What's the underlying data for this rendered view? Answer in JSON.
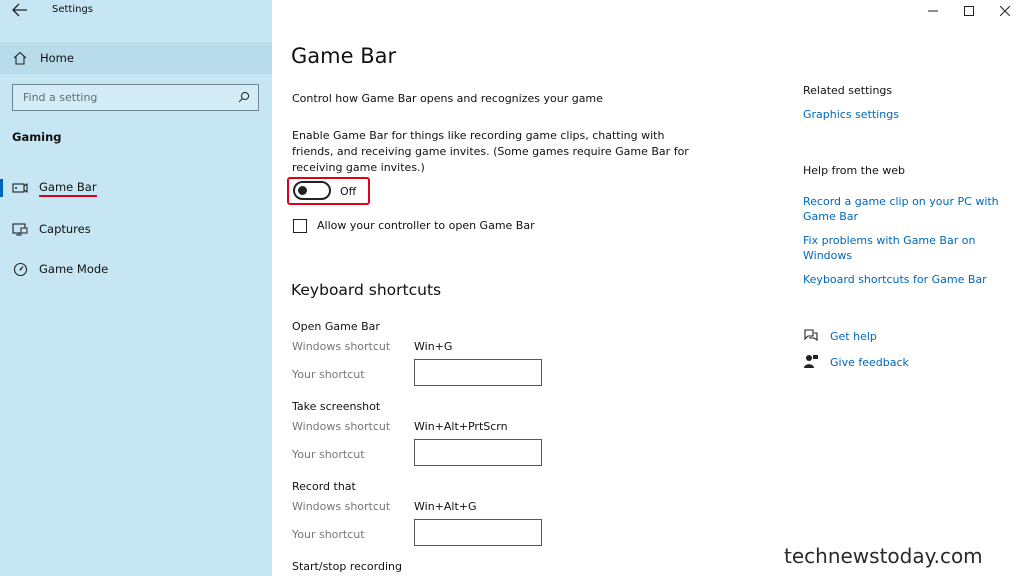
{
  "window": {
    "title": "Settings"
  },
  "sidebar": {
    "home_label": "Home",
    "search_placeholder": "Find a setting",
    "section_label": "Gaming",
    "items": [
      {
        "label": "Game Bar",
        "icon": "game-bar-icon",
        "selected": true
      },
      {
        "label": "Captures",
        "icon": "captures-icon",
        "selected": false
      },
      {
        "label": "Game Mode",
        "icon": "game-mode-icon",
        "selected": false
      }
    ]
  },
  "main": {
    "title": "Game Bar",
    "description": "Control how Game Bar opens and recognizes your game",
    "enable_text": "Enable Game Bar for things like recording game clips, chatting with friends, and receiving game invites. (Some games require Game Bar for receiving game invites.)",
    "toggle": {
      "state_label": "Off",
      "on": false
    },
    "controller_checkbox": {
      "label": "Allow your controller to open Game Bar",
      "checked": false
    },
    "keyboard_shortcuts": {
      "title": "Keyboard shortcuts",
      "windows_label": "Windows shortcut",
      "your_label": "Your shortcut",
      "groups": [
        {
          "title": "Open Game Bar",
          "windows_shortcut": "Win+G",
          "your_shortcut": ""
        },
        {
          "title": "Take screenshot",
          "windows_shortcut": "Win+Alt+PrtScrn",
          "your_shortcut": ""
        },
        {
          "title": "Record that",
          "windows_shortcut": "Win+Alt+G",
          "your_shortcut": ""
        },
        {
          "title": "Start/stop recording"
        }
      ]
    }
  },
  "right": {
    "related_title": "Related settings",
    "related_links": [
      "Graphics settings"
    ],
    "help_title": "Help from the web",
    "help_links": [
      "Record a game clip on your PC with Game Bar",
      "Fix problems with Game Bar on Windows",
      "Keyboard shortcuts for Game Bar"
    ],
    "get_help": "Get help",
    "give_feedback": "Give feedback"
  },
  "watermark": "technewstoday.com",
  "colors": {
    "sidebar_bg": "#c5e6f2",
    "accent": "#0067b8",
    "highlight_red": "#e0001b"
  }
}
